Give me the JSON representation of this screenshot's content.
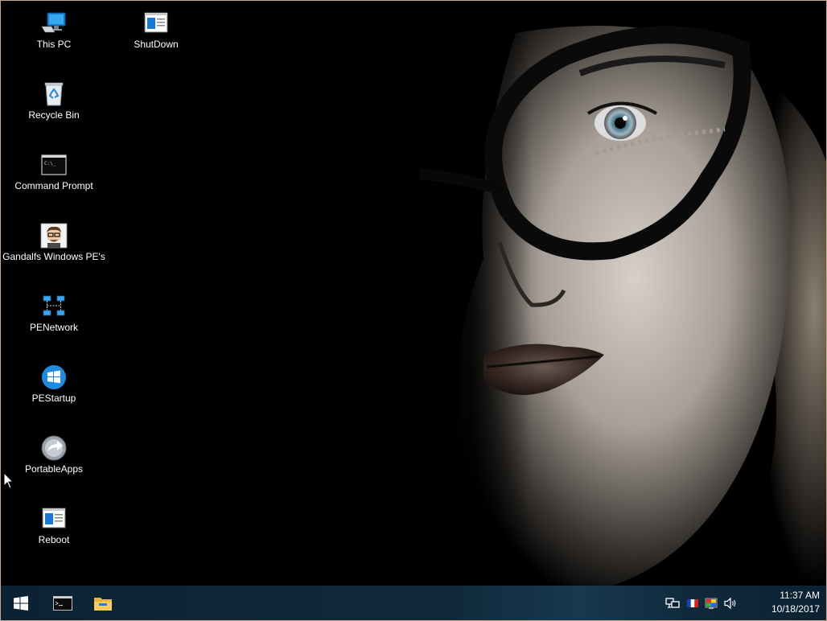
{
  "desktop": {
    "icons": [
      {
        "id": "this-pc",
        "label": "This PC"
      },
      {
        "id": "shutdown",
        "label": "ShutDown"
      },
      {
        "id": "recycle-bin",
        "label": "Recycle Bin"
      },
      {
        "id": "command-prompt",
        "label": "Command Prompt"
      },
      {
        "id": "gandalfs",
        "label": "Gandalfs Windows PE's"
      },
      {
        "id": "penetwork",
        "label": "PENetwork"
      },
      {
        "id": "pestartup",
        "label": "PEStartup"
      },
      {
        "id": "portableapps",
        "label": "PortableApps"
      },
      {
        "id": "reboot",
        "label": "Reboot"
      }
    ],
    "cmd_prompt_glyph": "C:\\_"
  },
  "taskbar": {
    "pinned": [
      {
        "icon": "windows-start-icon"
      },
      {
        "icon": "command-prompt-icon"
      },
      {
        "icon": "file-explorer-icon"
      }
    ],
    "tray": [
      {
        "icon": "network-icon"
      },
      {
        "icon": "language-flag-icon"
      },
      {
        "icon": "color-settings-icon"
      },
      {
        "icon": "volume-icon"
      }
    ],
    "clock": {
      "time": "11:37 AM",
      "date": "10/18/2017"
    }
  },
  "colors": {
    "taskbar_bg": "#0c2233",
    "icon_text": "#ffffff",
    "accent_blue": "#1a8fe0"
  }
}
